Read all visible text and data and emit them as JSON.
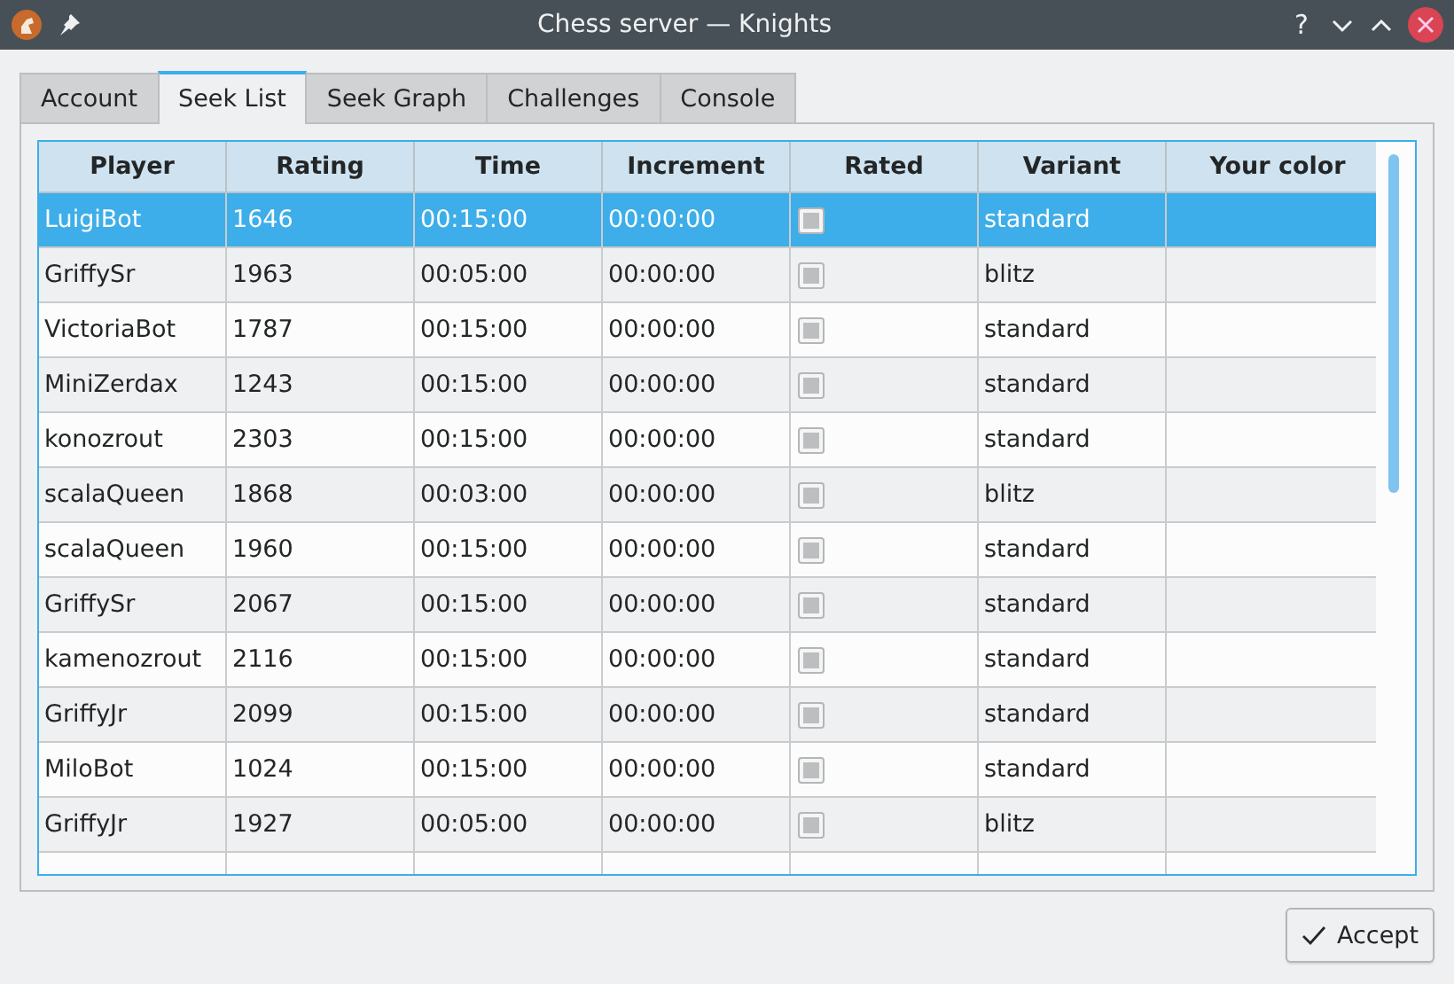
{
  "window": {
    "title": "Chess server — Knights",
    "buttons": [
      "?"
    ]
  },
  "tabs": [
    {
      "label": "Account",
      "selected": false
    },
    {
      "label": "Seek List",
      "selected": true
    },
    {
      "label": "Seek Graph",
      "selected": false
    },
    {
      "label": "Challenges",
      "selected": false
    },
    {
      "label": "Console",
      "selected": false
    }
  ],
  "table": {
    "columns": [
      "Player",
      "Rating",
      "Time",
      "Increment",
      "Rated",
      "Variant",
      "Your color"
    ],
    "rows": [
      {
        "player": "LuigiBot",
        "rating": "1646",
        "time": "00:15:00",
        "increment": "00:00:00",
        "rated": false,
        "variant": "standard",
        "selected": true
      },
      {
        "player": "GriffySr",
        "rating": "1963",
        "time": "00:05:00",
        "increment": "00:00:00",
        "rated": false,
        "variant": "blitz",
        "selected": false
      },
      {
        "player": "VictoriaBot",
        "rating": "1787",
        "time": "00:15:00",
        "increment": "00:00:00",
        "rated": false,
        "variant": "standard",
        "selected": false
      },
      {
        "player": "MiniZerdax",
        "rating": "1243",
        "time": "00:15:00",
        "increment": "00:00:00",
        "rated": false,
        "variant": "standard",
        "selected": false
      },
      {
        "player": "konozrout",
        "rating": "2303",
        "time": "00:15:00",
        "increment": "00:00:00",
        "rated": false,
        "variant": "standard",
        "selected": false
      },
      {
        "player": "scalaQueen",
        "rating": "1868",
        "time": "00:03:00",
        "increment": "00:00:00",
        "rated": false,
        "variant": "blitz",
        "selected": false
      },
      {
        "player": "scalaQueen",
        "rating": "1960",
        "time": "00:15:00",
        "increment": "00:00:00",
        "rated": false,
        "variant": "standard",
        "selected": false
      },
      {
        "player": "GriffySr",
        "rating": "2067",
        "time": "00:15:00",
        "increment": "00:00:00",
        "rated": false,
        "variant": "standard",
        "selected": false
      },
      {
        "player": "kamenozrout",
        "rating": "2116",
        "time": "00:15:00",
        "increment": "00:00:00",
        "rated": false,
        "variant": "standard",
        "selected": false
      },
      {
        "player": "GriffyJr",
        "rating": "2099",
        "time": "00:15:00",
        "increment": "00:00:00",
        "rated": false,
        "variant": "standard",
        "selected": false
      },
      {
        "player": "MiloBot",
        "rating": "1024",
        "time": "00:15:00",
        "increment": "00:00:00",
        "rated": false,
        "variant": "standard",
        "selected": false
      },
      {
        "player": "GriffyJr",
        "rating": "1927",
        "time": "00:05:00",
        "increment": "00:00:00",
        "rated": false,
        "variant": "blitz",
        "selected": false
      }
    ]
  },
  "buttons": [
    {
      "label": "Accept"
    }
  ]
}
